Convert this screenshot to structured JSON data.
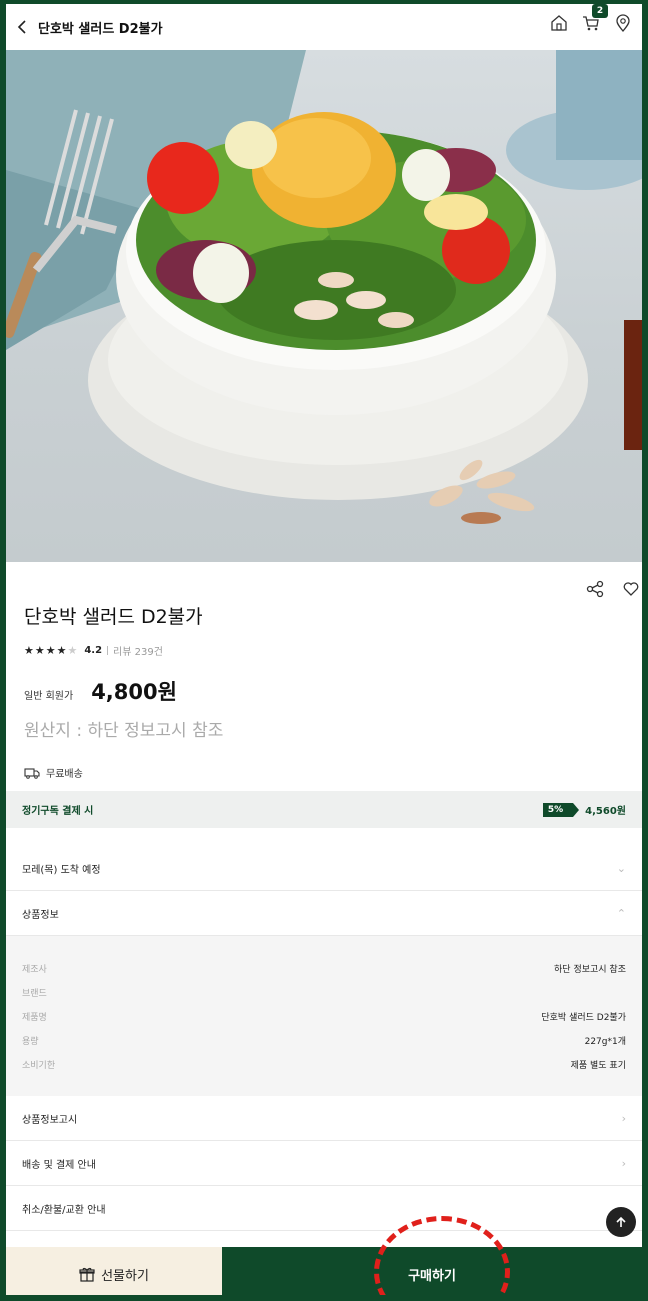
{
  "header": {
    "title": "단호박 샐러드 D2불가",
    "cart_count": "2"
  },
  "product": {
    "name": "단호박 샐러드 D2불가",
    "rating": "4.2",
    "review_label": "리뷰 239건",
    "price_label": "일반 회원가",
    "price": "4,800원",
    "origin": "원산지 : 하단 정보고시 참조",
    "shipping": "무료배송"
  },
  "subscription": {
    "label": "정기구독 결제 시",
    "discount": "5%",
    "price": "4,560원"
  },
  "rows": {
    "delivery": "모레(목) 도착 예정",
    "product_info": "상품정보",
    "notice": "상품정보고시",
    "shipping_payment": "배송 및 결제 안내",
    "cancel_refund": "취소/환불/교환 안내"
  },
  "spec": [
    {
      "key": "제조사",
      "value": "하단 정보고시 참조"
    },
    {
      "key": "브랜드",
      "value": ""
    },
    {
      "key": "제품명",
      "value": "단호박 샐러드 D2불가"
    },
    {
      "key": "용량",
      "value": "227g*1개"
    },
    {
      "key": "소비기한",
      "value": "제품 별도 표기"
    }
  ],
  "bottom": {
    "gift": "선물하기",
    "buy": "구매하기"
  },
  "colors": {
    "brand": "#0f4a2a",
    "annotation": "#e0201b"
  }
}
